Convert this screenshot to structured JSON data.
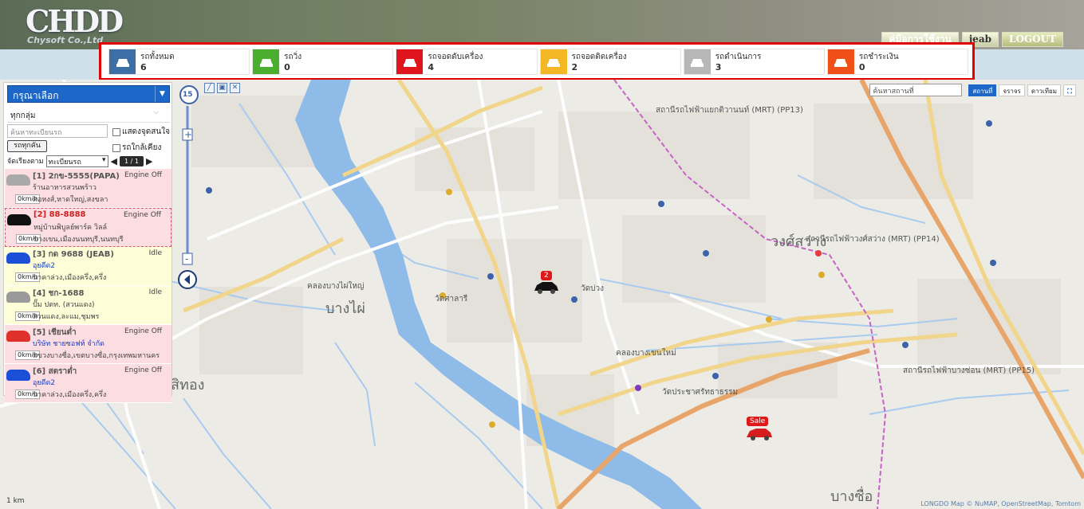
{
  "header": {
    "logo_text": "CHDD",
    "logo_sub": "Chysoft Co.,Ltd",
    "buttons": {
      "manual": "คู่มือการใช้งาน",
      "user": "jeab",
      "logout": "LOGOUT"
    }
  },
  "status_cards": [
    {
      "label": "รถทั้งหมด",
      "count": "6",
      "color": "#3d6ea6"
    },
    {
      "label": "รถวิ่ง",
      "count": "0",
      "color": "#4cae2e"
    },
    {
      "label": "รถจอดดับเครื่อง",
      "count": "4",
      "color": "#e0141c"
    },
    {
      "label": "รถจอดติดเครื่อง",
      "count": "2",
      "color": "#f4b827"
    },
    {
      "label": "รถดำเนินการ",
      "count": "3",
      "color": "#b7b7b7"
    },
    {
      "label": "รถชำระเงิน",
      "count": "0",
      "color": "#f04f18"
    }
  ],
  "panel": {
    "select_label": "กรุณาเลือก",
    "group_label": "ทุกกลุ่ม",
    "search_placeholder": "ค้นหาทะเบียนรถ",
    "show_poi": "แสดงจุดสนใจ",
    "nearby": "รถใกล้เคียง",
    "search_button": "รถทุกคัน",
    "sort_label": "จัดเรียงตาม",
    "sort_value": "ทะเบียนรถ",
    "pager": "1 / 1"
  },
  "vehicles": [
    {
      "name": "[1] 2กข-5555(PAPA)",
      "state": "Engine Off",
      "addr": "ร้านอาหารสวนพร้าว",
      "speed": "0km/h",
      "loc": "คอหงส์,หาดใหญ่,สงขลา",
      "style": "pink",
      "car_color": "#a9a9a9",
      "name_red": false,
      "addr_blue": false
    },
    {
      "name": "[2] 88-8888",
      "state": "Engine Off",
      "addr": "หมู่บ้านพิบูลย์พาร์ค วิลล์",
      "speed": "0km/h",
      "loc": "บางเขน,เมืองนนทบุรี,นนทบุรี",
      "style": "sel2",
      "car_color": "#111111",
      "name_red": true,
      "addr_blue": false
    },
    {
      "name": "[3] กด 9688 (JEAB)",
      "state": "Idle",
      "addr": "อุยดีด2",
      "speed": "0km/h",
      "loc": "นาคาล่วง,เมืองครึ่ง,ครึ่ง",
      "style": "yellow",
      "car_color": "#1c4fd8",
      "name_red": false,
      "addr_blue": true
    },
    {
      "name": "[4] ชก-1688",
      "state": "Idle",
      "addr": "ปั๊ม ปตท. (สวนแดง)",
      "speed": "0km/h",
      "loc": "สวนแดง,ละแม,ชุมพร",
      "style": "yellow",
      "car_color": "#9a9a9a",
      "name_red": false,
      "addr_blue": false
    },
    {
      "name": "[5] เชียนต่ำ",
      "state": "Engine Off",
      "addr": "บริษัท ชายซอฟท์ จำกัด",
      "speed": "0km/h",
      "loc": "แขวงบางซื่อ,เขตบางซื่อ,กรุงเทพมหานคร",
      "style": "pink",
      "car_color": "#e0302a",
      "name_red": false,
      "addr_blue": true
    },
    {
      "name": "[6] สตราต่ำ",
      "state": "Engine Off",
      "addr": "อุยดีด2",
      "speed": "0km/h",
      "loc": "นาคาล่วง,เมืองครึ่ง,ครึ่ง",
      "style": "pink",
      "car_color": "#1c4fd8",
      "name_red": false,
      "addr_blue": true
    }
  ],
  "map": {
    "zoom_level": "15",
    "search_placeholder": "ค้นหาสถานที่",
    "btn_search": "สถานที่",
    "btn_traffic": "จราจร",
    "btn_satellite": "ดาวเทียม",
    "marker_badge": "2",
    "sale_badge": "Sale",
    "attribution": "LONGDO Map © NuMAP, OpenStreetMap, Tomtom",
    "scale": "1 km",
    "labels": [
      {
        "t": "บางไผ่",
        "cls": "big"
      },
      {
        "t": "สถานีรถไฟฟ้าแยกติวานนท์ (MRT) (PP13)",
        "cls": ""
      },
      {
        "t": "สถานีรถไฟฟ้าวงศ์สว่าง (MRT) (PP14)",
        "cls": ""
      },
      {
        "t": "สถานีรถไฟฟ้าบางซ่อน (MRT) (PP15)",
        "cls": ""
      },
      {
        "t": "สิทอง",
        "cls": "big"
      },
      {
        "t": "วงศ์สว่าง",
        "cls": "big"
      },
      {
        "t": "บางซื่อ",
        "cls": "big"
      },
      {
        "t": "คลองบางไผ่ใหญ่",
        "cls": ""
      },
      {
        "t": "คลองบางเขนใหม่",
        "cls": ""
      },
      {
        "t": "วัดประชาศรัทธาธรรม",
        "cls": ""
      },
      {
        "t": "วัดศาลารี",
        "cls": ""
      },
      {
        "t": "วัดบ่วง",
        "cls": ""
      }
    ]
  }
}
